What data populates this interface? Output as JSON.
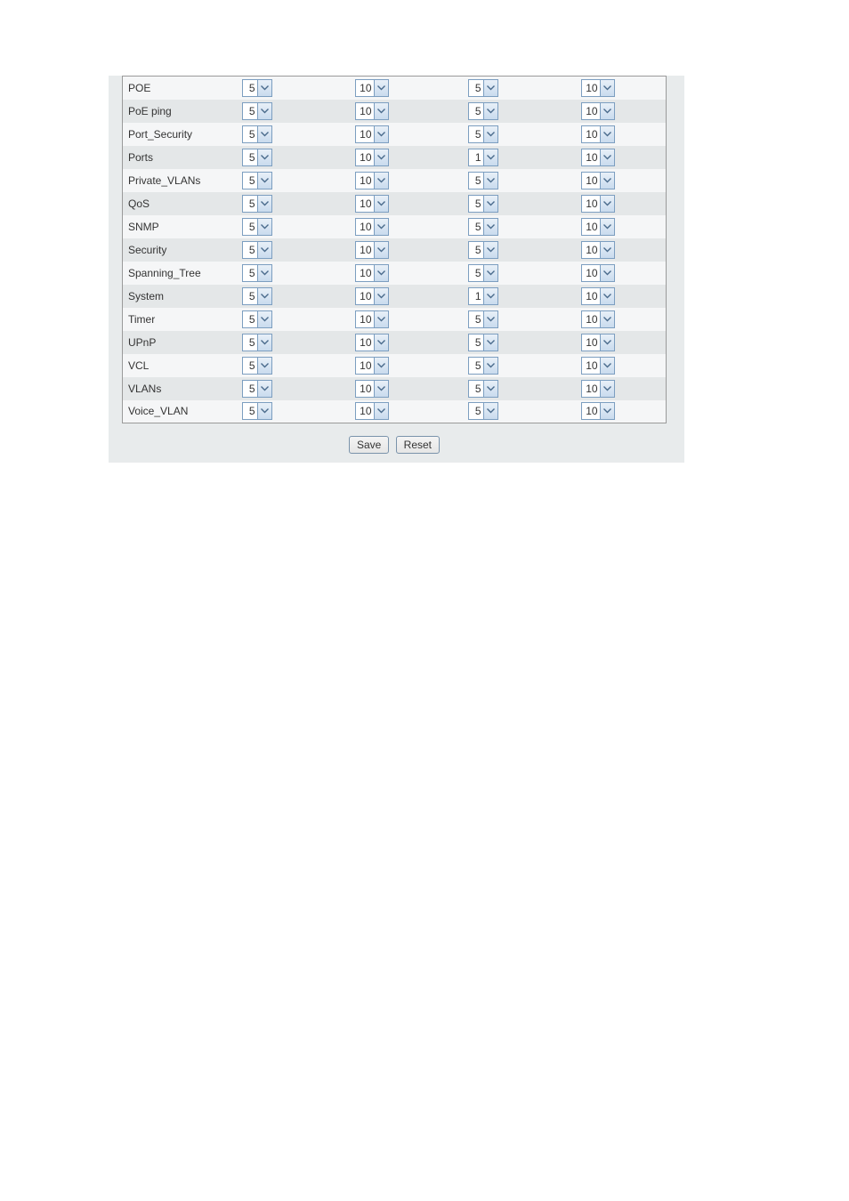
{
  "rows": [
    {
      "name": "POE",
      "c1": "5",
      "c2": "10",
      "c3": "5",
      "c4": "10"
    },
    {
      "name": "PoE ping",
      "c1": "5",
      "c2": "10",
      "c3": "5",
      "c4": "10"
    },
    {
      "name": "Port_Security",
      "c1": "5",
      "c2": "10",
      "c3": "5",
      "c4": "10"
    },
    {
      "name": "Ports",
      "c1": "5",
      "c2": "10",
      "c3": "1",
      "c4": "10"
    },
    {
      "name": "Private_VLANs",
      "c1": "5",
      "c2": "10",
      "c3": "5",
      "c4": "10"
    },
    {
      "name": "QoS",
      "c1": "5",
      "c2": "10",
      "c3": "5",
      "c4": "10"
    },
    {
      "name": "SNMP",
      "c1": "5",
      "c2": "10",
      "c3": "5",
      "c4": "10"
    },
    {
      "name": "Security",
      "c1": "5",
      "c2": "10",
      "c3": "5",
      "c4": "10"
    },
    {
      "name": "Spanning_Tree",
      "c1": "5",
      "c2": "10",
      "c3": "5",
      "c4": "10"
    },
    {
      "name": "System",
      "c1": "5",
      "c2": "10",
      "c3": "1",
      "c4": "10"
    },
    {
      "name": "Timer",
      "c1": "5",
      "c2": "10",
      "c3": "5",
      "c4": "10"
    },
    {
      "name": "UPnP",
      "c1": "5",
      "c2": "10",
      "c3": "5",
      "c4": "10"
    },
    {
      "name": "VCL",
      "c1": "5",
      "c2": "10",
      "c3": "5",
      "c4": "10"
    },
    {
      "name": "VLANs",
      "c1": "5",
      "c2": "10",
      "c3": "5",
      "c4": "10"
    },
    {
      "name": "Voice_VLAN",
      "c1": "5",
      "c2": "10",
      "c3": "5",
      "c4": "10"
    }
  ],
  "buttons": {
    "save": "Save",
    "reset": "Reset"
  }
}
